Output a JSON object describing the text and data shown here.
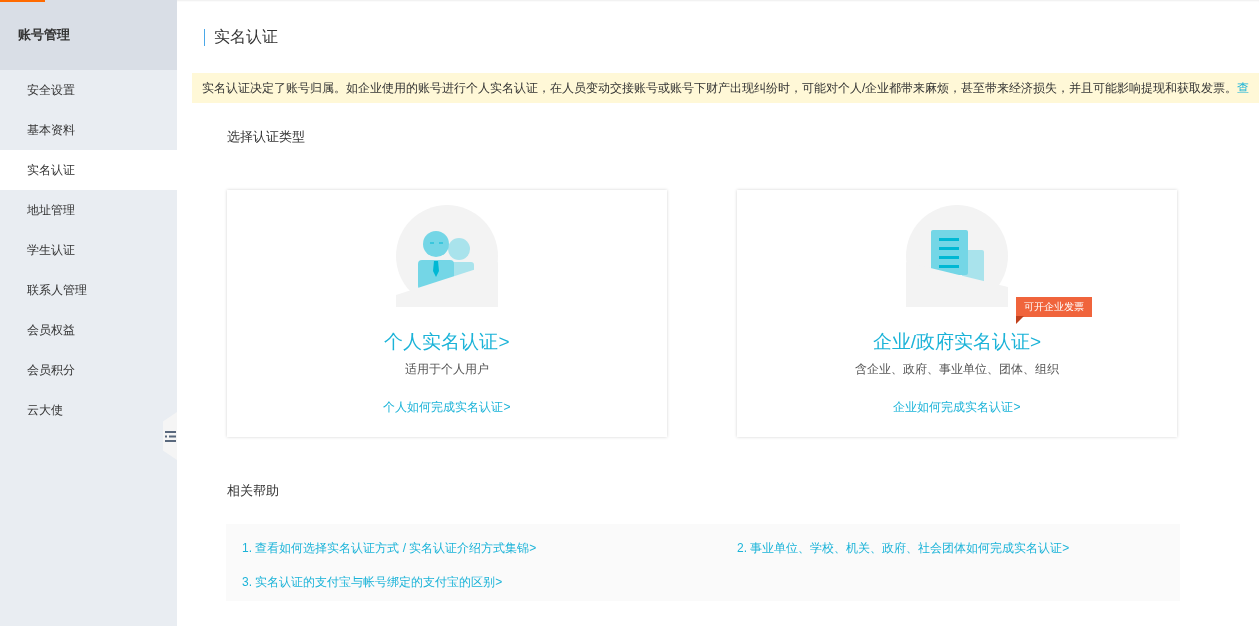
{
  "sidebar": {
    "header": "账号管理",
    "items": [
      {
        "label": "安全设置",
        "selected": false
      },
      {
        "label": "基本资料",
        "selected": false
      },
      {
        "label": "实名认证",
        "selected": true
      },
      {
        "label": "地址管理",
        "selected": false
      },
      {
        "label": "学生认证",
        "selected": false
      },
      {
        "label": "联系人管理",
        "selected": false
      },
      {
        "label": "会员权益",
        "selected": false
      },
      {
        "label": "会员积分",
        "selected": false
      },
      {
        "label": "云大使",
        "selected": false
      }
    ]
  },
  "page_title": "实名认证",
  "notice": {
    "text": "实名认证决定了账号归属。如企业使用的账号进行个人实名认证，在人员变动交接账号或账号下财产出现纠纷时，可能对个人/企业都带来麻烦，甚至带来经济损失，并且可能影响提现和获取发票。",
    "link": "查"
  },
  "section_title": "选择认证类型",
  "cards": [
    {
      "kind": "personal",
      "title": "个人实名认证>",
      "subtitle": "适用于个人用户",
      "link": "个人如何完成实名认证>"
    },
    {
      "kind": "enterprise",
      "title": "企业/政府实名认证>",
      "subtitle": "含企业、政府、事业单位、团体、组织",
      "link": "企业如何完成实名认证>",
      "badge": "可开企业发票"
    }
  ],
  "help": {
    "title": "相关帮助",
    "links": [
      "1. 查看如何选择实名认证方式 / 实名认证介绍方式集锦>",
      "2. 事业单位、学校、机关、政府、社会团体如何完成实名认证>",
      "3. 实名认证的支付宝与帐号绑定的支付宝的区别>"
    ]
  }
}
